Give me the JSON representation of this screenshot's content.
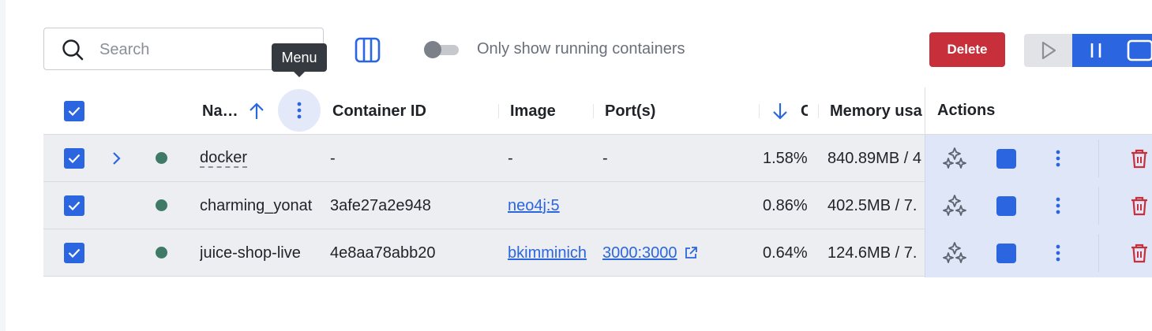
{
  "toolbar": {
    "search_placeholder": "Search",
    "tooltip": "Menu",
    "toggle_label": "Only show running containers",
    "delete_label": "Delete"
  },
  "table": {
    "columns": {
      "name": "Na…",
      "container_id": "Container ID",
      "image": "Image",
      "ports": "Port(s)",
      "cpu": "C",
      "memory": "Memory usa",
      "actions": "Actions"
    },
    "rows": [
      {
        "name": "docker",
        "container_id": "-",
        "image": "-",
        "ports": "-",
        "cpu": "1.58%",
        "memory": "840.89MB / 4"
      },
      {
        "name": "charming_yonat",
        "container_id": "3afe27a2e948",
        "image": "neo4j:5",
        "ports": "",
        "cpu": "0.86%",
        "memory": "402.5MB / 7."
      },
      {
        "name": "juice-shop-live",
        "container_id": "4e8aa78abb20",
        "image": "bkimminich",
        "ports": "3000:3000",
        "cpu": "0.64%",
        "memory": "124.6MB / 7."
      }
    ]
  },
  "colors": {
    "accent": "#2b66e0",
    "danger": "#c7303a",
    "running": "#3f7a67"
  }
}
